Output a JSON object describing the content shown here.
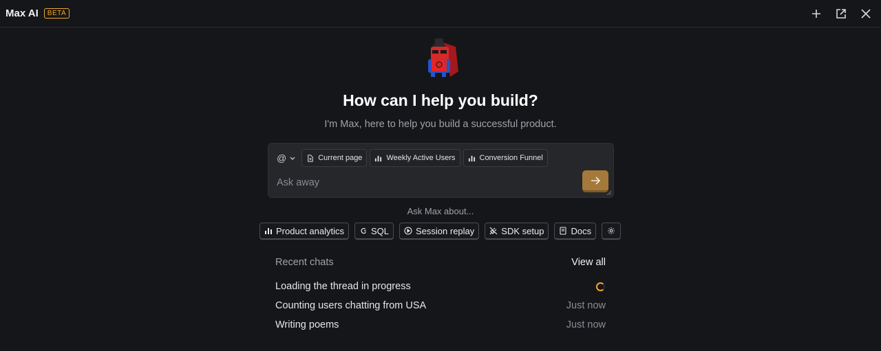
{
  "header": {
    "title": "Max AI",
    "badge": "BETA",
    "actions": [
      "plus-icon",
      "open-external-icon",
      "close-icon"
    ]
  },
  "hero": {
    "headline": "How can I help you build?",
    "subhead": "I'm Max, here to help you build a successful product."
  },
  "composer": {
    "at_label": "@",
    "context_chips": [
      {
        "label": "Current page",
        "icon": "document-icon"
      },
      {
        "label": "Weekly Active Users",
        "icon": "bar-chart-icon"
      },
      {
        "label": "Conversion Funnel",
        "icon": "bar-chart-icon"
      }
    ],
    "placeholder": "Ask away",
    "value": ""
  },
  "suggestions": {
    "title": "Ask Max about...",
    "items": [
      {
        "label": "Product analytics",
        "icon": "bar-chart-icon"
      },
      {
        "label": "SQL",
        "icon": "sql-icon"
      },
      {
        "label": "Session replay",
        "icon": "play-circle-icon"
      },
      {
        "label": "SDK setup",
        "icon": "plug-icon"
      },
      {
        "label": "Docs",
        "icon": "book-icon"
      }
    ],
    "settings_icon": "gear-icon"
  },
  "recent": {
    "title": "Recent chats",
    "view_all": "View all",
    "chats": [
      {
        "title": "Loading the thread in progress",
        "status": "loading"
      },
      {
        "title": "Counting users chatting from USA",
        "time": "Just now"
      },
      {
        "title": "Writing poems",
        "time": "Just now"
      }
    ]
  },
  "colors": {
    "background": "#151619",
    "accent": "#f1a82c",
    "send_button": "#a5793a"
  }
}
